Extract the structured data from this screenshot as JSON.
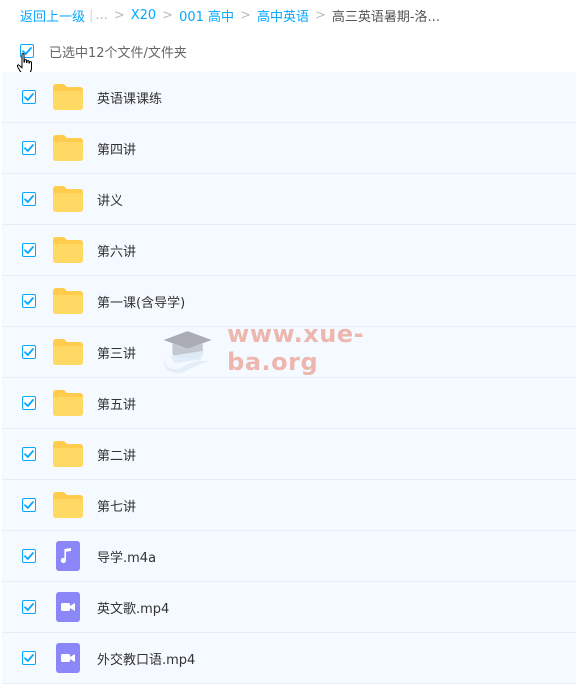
{
  "breadcrumb": {
    "back": "返回上一级",
    "ellipsis": "...",
    "items": [
      "X20",
      "001 高中",
      "高中英语"
    ],
    "current": "高三英语暑期-洛..."
  },
  "selection": {
    "label": "已选中12个文件/文件夹",
    "checked": true
  },
  "files": [
    {
      "name": "英语课课练",
      "type": "folder",
      "checked": true
    },
    {
      "name": "第四讲",
      "type": "folder",
      "checked": true
    },
    {
      "name": "讲义",
      "type": "folder",
      "checked": true
    },
    {
      "name": "第六讲",
      "type": "folder",
      "checked": true
    },
    {
      "name": "第一课(含导学)",
      "type": "folder",
      "checked": true
    },
    {
      "name": "第三讲",
      "type": "folder",
      "checked": true
    },
    {
      "name": "第五讲",
      "type": "folder",
      "checked": true
    },
    {
      "name": "第二讲",
      "type": "folder",
      "checked": true
    },
    {
      "name": "第七讲",
      "type": "folder",
      "checked": true
    },
    {
      "name": "导学.m4a",
      "type": "audio",
      "checked": true
    },
    {
      "name": "英文歌.mp4",
      "type": "video",
      "checked": true
    },
    {
      "name": "外交教口语.mp4",
      "type": "video",
      "checked": true
    }
  ],
  "watermark": {
    "text": "www.xue-ba.org"
  },
  "colors": {
    "accent": "#06a7ff",
    "folder": "#ffd45c",
    "media": "#8c87f8",
    "row_bg": "#f4faff",
    "row_border": "#e4eef7"
  }
}
